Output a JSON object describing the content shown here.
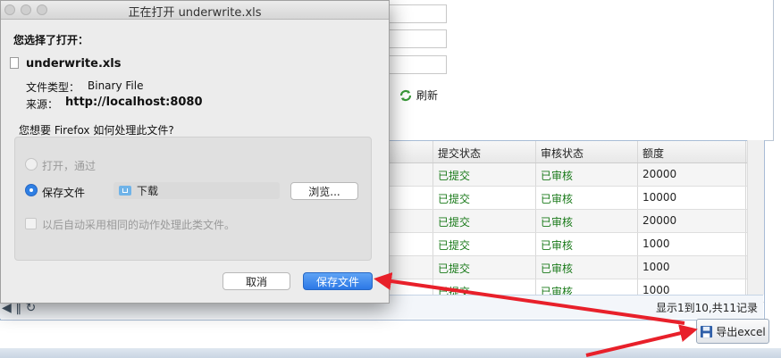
{
  "background_page": {
    "refresh_label": "刷新",
    "table": {
      "headers": [
        "",
        "提交状态",
        "审核状态",
        "额度"
      ],
      "rows": [
        {
          "status": "已提交",
          "review": "已审核",
          "amount": "20000"
        },
        {
          "status": "已提交",
          "review": "已审核",
          "amount": "10000"
        },
        {
          "status": "已提交",
          "review": "已审核",
          "amount": "20000"
        },
        {
          "status": "已提交",
          "review": "已审核",
          "amount": "1000"
        },
        {
          "status": "已提交",
          "review": "已审核",
          "amount": "1000"
        },
        {
          "status": "已提交",
          "review": "已审核",
          "amount": "1000"
        }
      ]
    },
    "pager_info": "显示1到10,共11记录",
    "export_button_label": "导出excel",
    "icons": {
      "refresh": "refresh-icon",
      "export": "floppy-save-icon"
    }
  },
  "dialog": {
    "title": "正在打开 underwrite.xls",
    "chosen_label": "您选择了打开：",
    "file_name": "underwrite.xls",
    "type_label": "文件类型：",
    "type_value": "Binary File",
    "source_label": "来源：",
    "source_value": "http://localhost:8080",
    "question": "您想要 Firefox 如何处理此文件?",
    "open_with_label": "打开，通过",
    "save_file_label": "保存文件",
    "save_folder": "下载",
    "browse_button": "浏览...",
    "auto_action_label": "以后自动采用相同的动作处理此类文件。",
    "cancel_button": "取消",
    "save_button": "保存文件",
    "selected_option": "保存文件"
  },
  "colors": {
    "accent_blue": "#2c78e6",
    "annotation_red": "#e8202a",
    "status_green": "#1a7a1a"
  }
}
